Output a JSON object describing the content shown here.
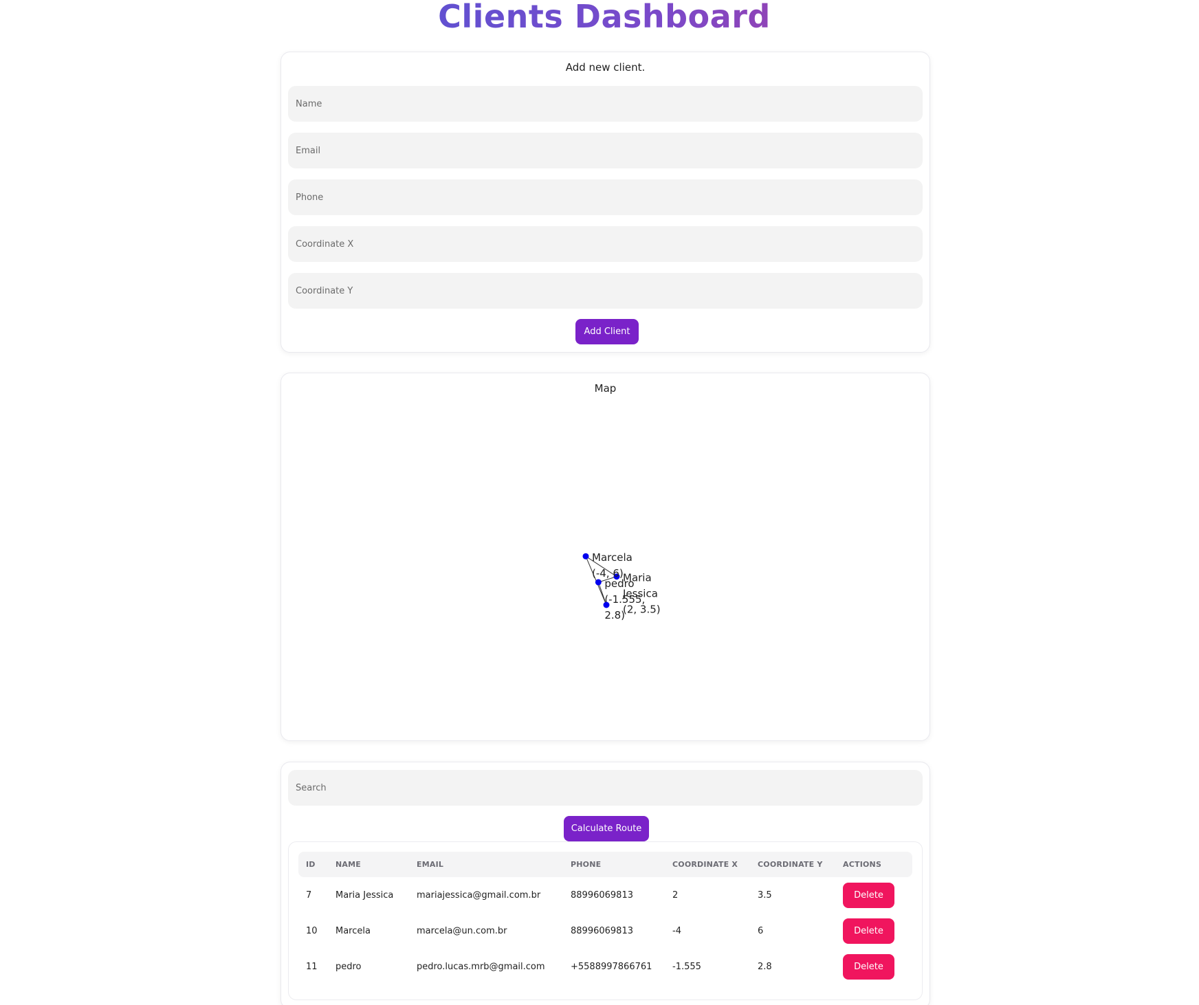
{
  "page": {
    "title": "Clients Dashboard"
  },
  "add_form": {
    "heading": "Add new client.",
    "fields": {
      "name_placeholder": "Name",
      "email_placeholder": "Email",
      "phone_placeholder": "Phone",
      "coord_x_placeholder": "Coordinate X",
      "coord_y_placeholder": "Coordinate Y"
    },
    "submit_label": "Add Client"
  },
  "map": {
    "heading": "Map",
    "points": [
      {
        "name": "Maria Jessica",
        "x": 2,
        "y": 3.5,
        "label_lines": [
          "Maria",
          "Jessica",
          "(2, 3.5)"
        ]
      },
      {
        "name": "Marcela",
        "x": -4,
        "y": 6,
        "label_lines": [
          "Marcela",
          "(-4, 6)"
        ]
      },
      {
        "name": "pedro",
        "x": -1.555,
        "y": 2.8,
        "label_lines": [
          "pedro",
          "(-1.555,",
          "2.8)"
        ]
      },
      {
        "name": "",
        "x": 0,
        "y": 0,
        "label_lines": []
      }
    ],
    "route_order": [
      3,
      1,
      0,
      2,
      3
    ],
    "point_color": "#0000ee",
    "line_color": "#333333"
  },
  "clients": {
    "search_placeholder": "Search",
    "calculate_label": "Calculate Route",
    "columns": [
      "ID",
      "NAME",
      "EMAIL",
      "PHONE",
      "COORDINATE X",
      "COORDINATE Y",
      "ACTIONS"
    ],
    "rows": [
      {
        "id": "7",
        "name": "Maria Jessica",
        "email": "mariajessica@gmail.com.br",
        "phone": "88996069813",
        "x": "2",
        "y": "3.5",
        "action": "Delete"
      },
      {
        "id": "10",
        "name": "Marcela",
        "email": "marcela@un.com.br",
        "phone": "88996069813",
        "x": "-4",
        "y": "6",
        "action": "Delete"
      },
      {
        "id": "11",
        "name": "pedro",
        "email": "pedro.lucas.mrb@gmail.com",
        "phone": "+5588997866761",
        "x": "-1.555",
        "y": "2.8",
        "action": "Delete"
      }
    ]
  },
  "colors": {
    "primary": "#7a22c9",
    "danger": "#f0155e",
    "title_gradient": [
      "#2f5fe0",
      "#7b49c9",
      "#e02b6f"
    ]
  }
}
